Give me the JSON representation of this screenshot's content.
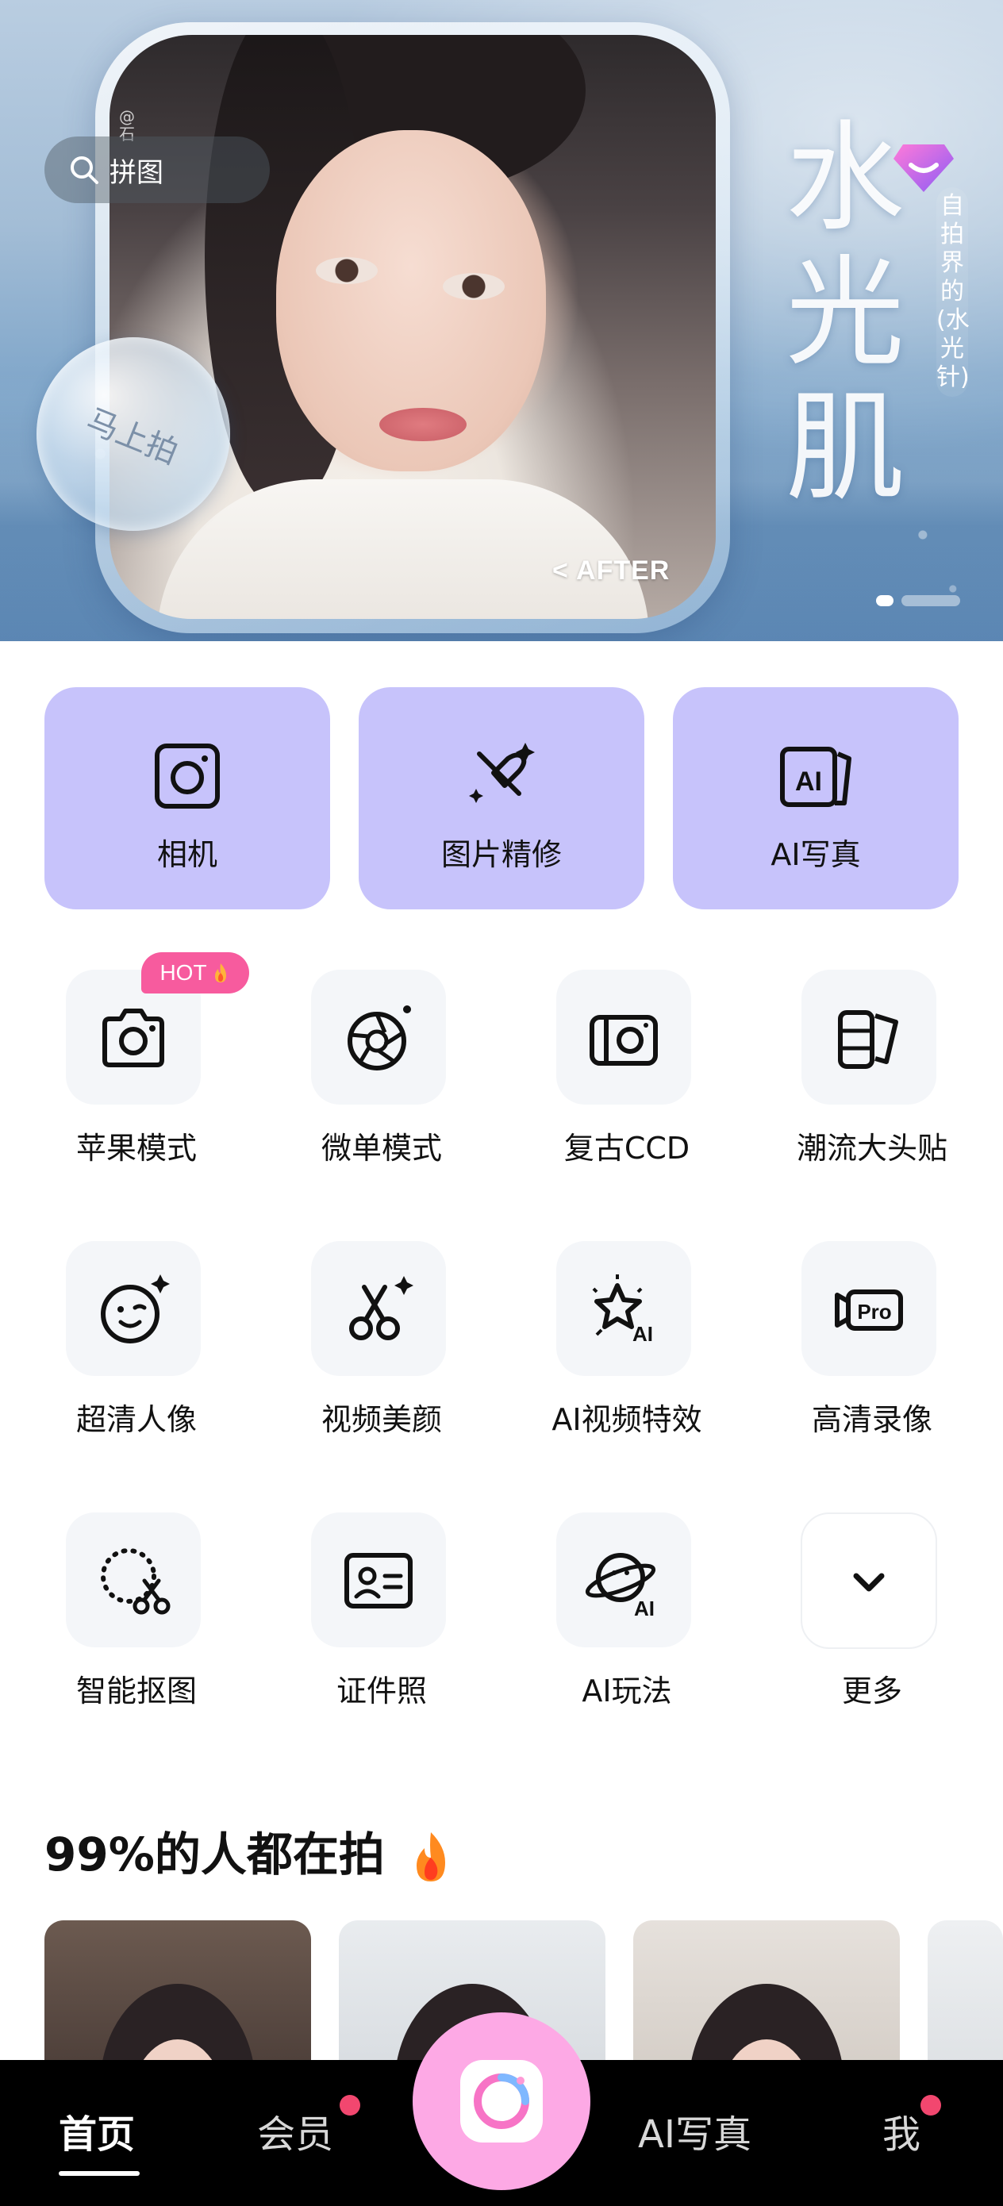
{
  "hero": {
    "search_label": "拼图",
    "watermark": "@石",
    "shoot_label": "马上拍",
    "title": "水光肌",
    "subtitle": "自拍界的(水光针)",
    "after_label": "< AFTER"
  },
  "primary_actions": [
    {
      "label": "相机",
      "icon": "camera-icon"
    },
    {
      "label": "图片精修",
      "icon": "makeup-brush-icon"
    },
    {
      "label": "AI写真",
      "icon": "ai-portrait-icon"
    }
  ],
  "tools": [
    {
      "label": "苹果模式",
      "icon": "camera-outline-icon",
      "badge": "HOT"
    },
    {
      "label": "微单模式",
      "icon": "aperture-icon"
    },
    {
      "label": "复古CCD",
      "icon": "ccd-camera-icon"
    },
    {
      "label": "潮流大头贴",
      "icon": "photo-strip-icon"
    },
    {
      "label": "超清人像",
      "icon": "smiley-face-icon"
    },
    {
      "label": "视频美颜",
      "icon": "scissors-sparkle-icon"
    },
    {
      "label": "AI视频特效",
      "icon": "ai-star-effect-icon"
    },
    {
      "label": "高清录像",
      "icon": "pro-video-icon"
    },
    {
      "label": "智能抠图",
      "icon": "cutout-icon"
    },
    {
      "label": "证件照",
      "icon": "id-card-icon"
    },
    {
      "label": "AI玩法",
      "icon": "ai-planet-icon"
    },
    {
      "label": "更多",
      "icon": "chevron-down-icon"
    }
  ],
  "section": {
    "title": "99%的人都在拍"
  },
  "bottom_nav": [
    {
      "label": "首页",
      "active": true
    },
    {
      "label": "会员",
      "dot": true
    },
    {
      "label": "AI写真"
    },
    {
      "label": "我",
      "dot": true
    }
  ],
  "colors": {
    "card_purple": "#c7c3fb",
    "hot_pink": "#f75b9e",
    "fab_pink": "#fda9e5",
    "notification_red": "#f2476f"
  }
}
